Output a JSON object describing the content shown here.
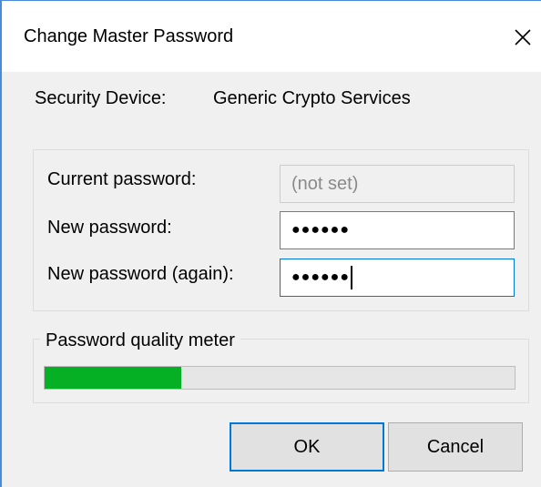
{
  "window": {
    "title": "Change Master Password",
    "close_icon": "close-icon"
  },
  "security_device": {
    "label": "Security Device:",
    "value": "Generic Crypto Services"
  },
  "fields": {
    "current": {
      "label": "Current password:",
      "placeholder": "(not set)",
      "enabled": false
    },
    "new": {
      "label": "New password:",
      "masked_value": "●●●●●●"
    },
    "confirm": {
      "label": "New password (again):",
      "masked_value": "●●●●●●",
      "focused": true
    }
  },
  "quality_meter": {
    "label": "Password quality meter",
    "level": 0.29,
    "color": "#06b025"
  },
  "buttons": {
    "ok": "OK",
    "cancel": "Cancel"
  },
  "colors": {
    "accent": "#0078d7",
    "dialog_bg": "#f0f0f0"
  }
}
